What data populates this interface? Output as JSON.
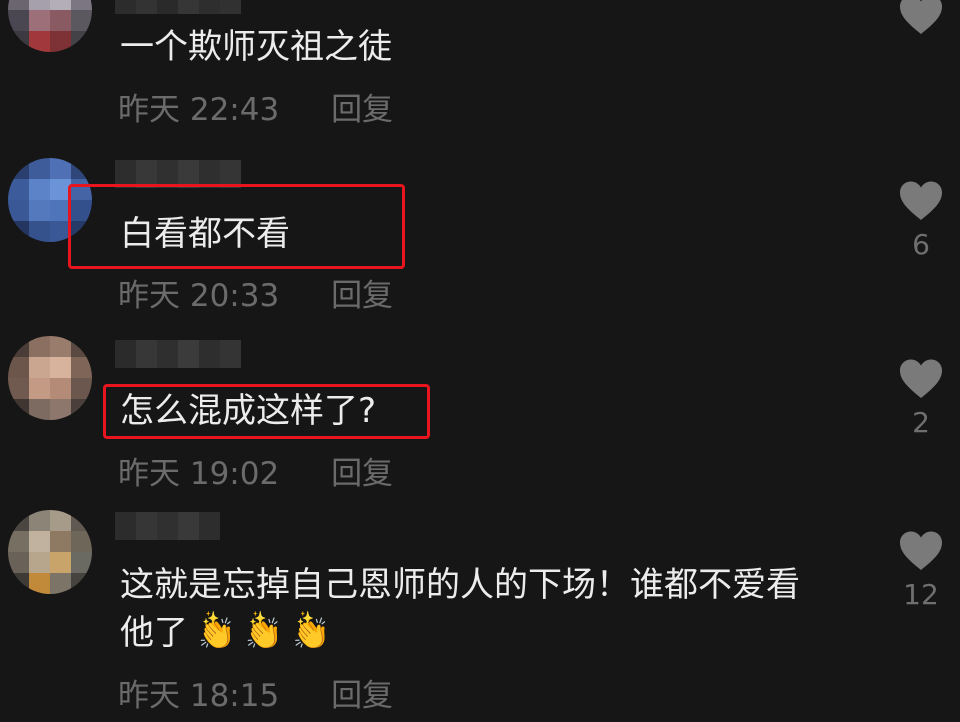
{
  "comments": [
    {
      "text": "一个欺师灭祖之徒",
      "time": "昨天 22:43",
      "reply": "回复",
      "likes": ""
    },
    {
      "text": "白看都不看",
      "time": "昨天 20:33",
      "reply": "回复",
      "likes": "6"
    },
    {
      "text": "怎么混成这样了?",
      "time": "昨天 19:02",
      "reply": "回复",
      "likes": "2"
    },
    {
      "text_line1": "这就是忘掉自己恩师的人的下场！谁都不爱看",
      "text_line2": "他了",
      "emoji": "👏",
      "time": "昨天 18:15",
      "reply": "回复",
      "likes": "12"
    }
  ],
  "colors": {
    "background": "#161616",
    "highlight": "#e8141e",
    "meta_text": "#6b6b6b",
    "heart": "#7a7a7a"
  },
  "icons": {
    "like": "heart-icon",
    "clap": "clapping-hands-emoji"
  }
}
